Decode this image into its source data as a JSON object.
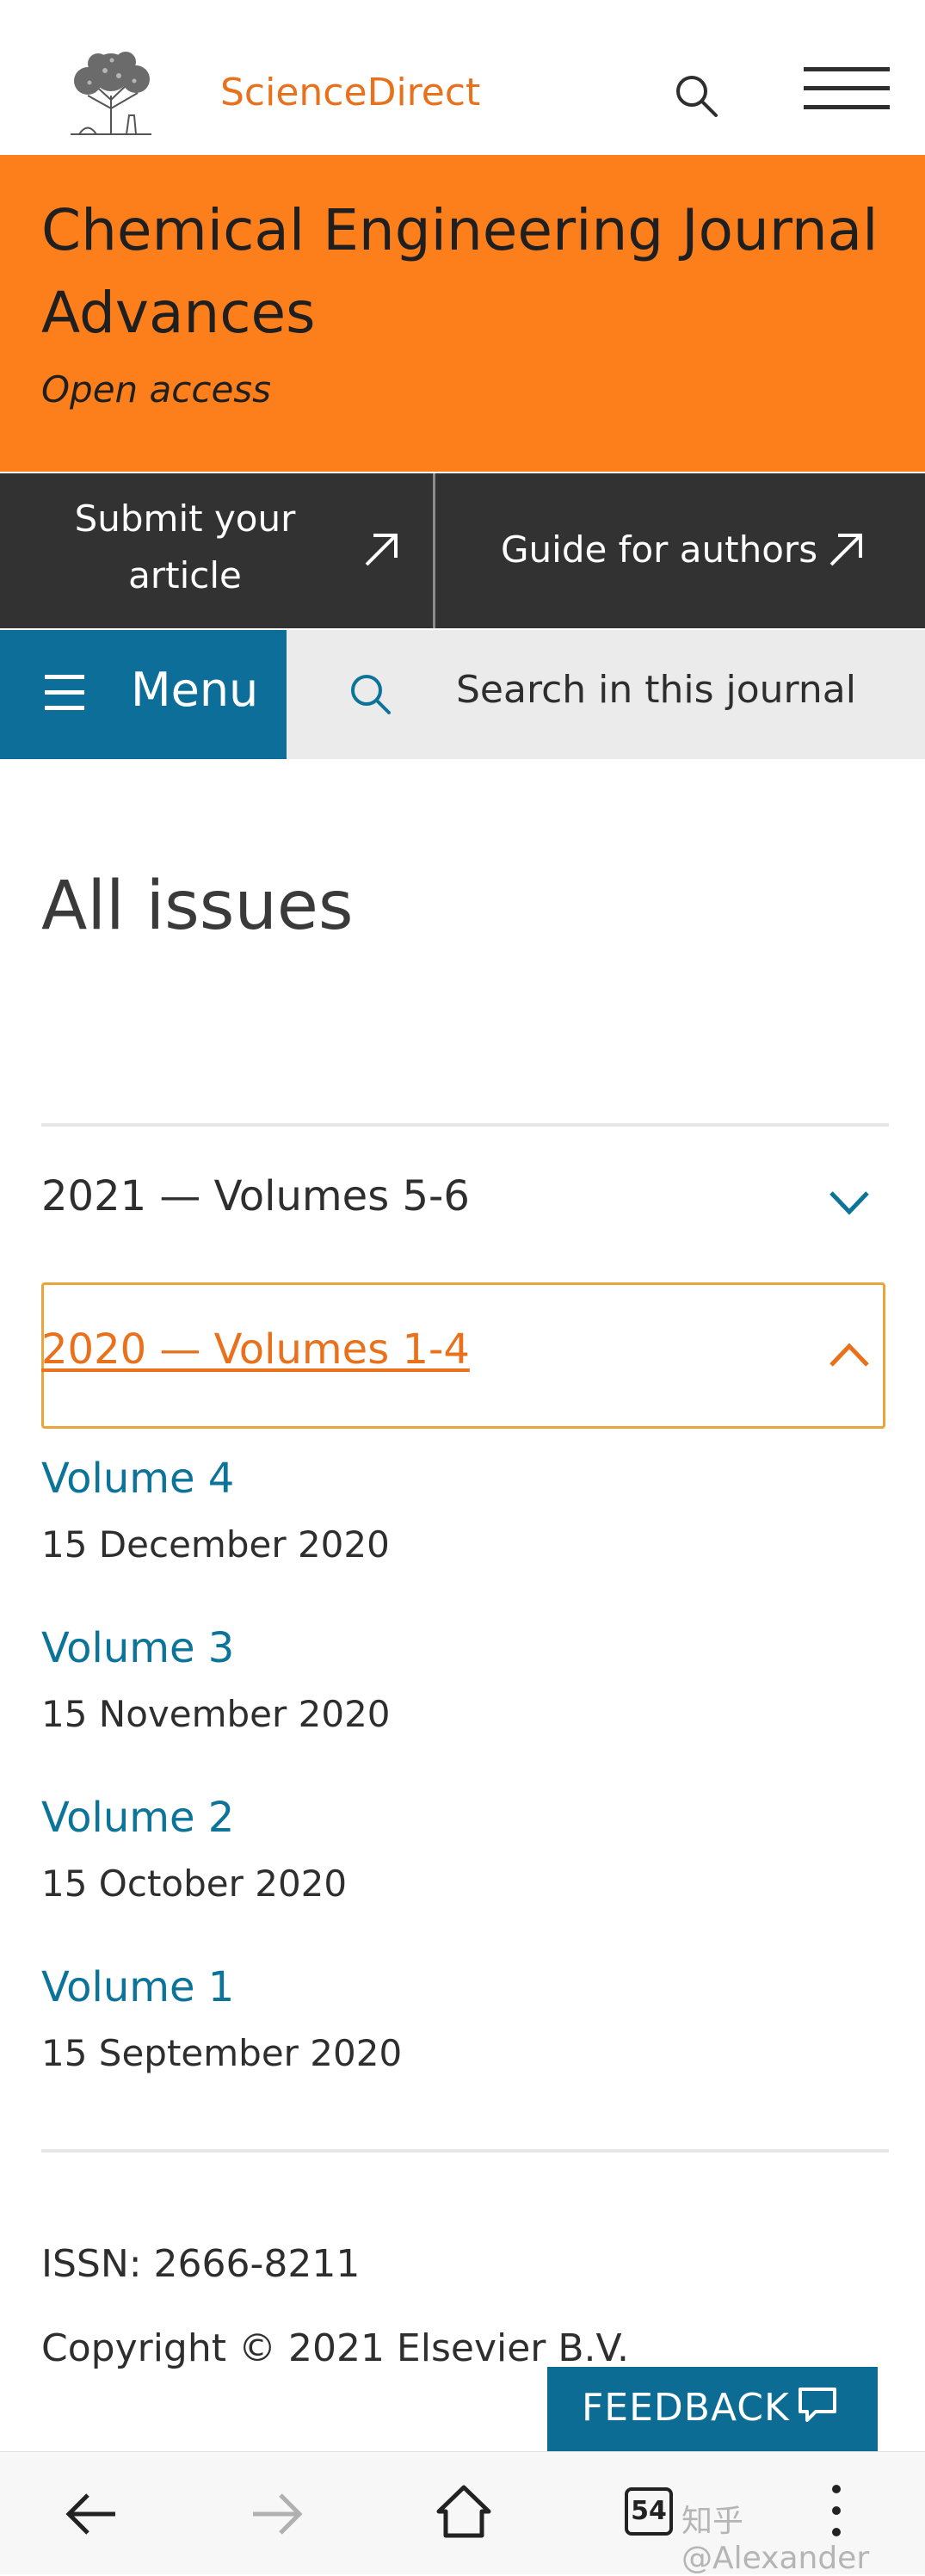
{
  "header": {
    "brand": "ScienceDirect",
    "logo_icon": "elsevier-tree-logo",
    "search_icon": "search-icon",
    "menu_icon": "hamburger-icon"
  },
  "journal": {
    "title": "Chemical Engineering Journal Advances",
    "access": "Open access",
    "banner_color": "#fd7f1c"
  },
  "actions": {
    "submit_line1": "Submit your",
    "submit_line2": "article",
    "guide": "Guide for authors"
  },
  "nav": {
    "menu_label": "Menu",
    "search_placeholder": "Search in this journal",
    "accent": "#0d6e99"
  },
  "main": {
    "page_title": "All issues",
    "accordions": [
      {
        "label": "2021 — Volumes 5-6",
        "expanded": false
      },
      {
        "label": "2020 — Volumes 1-4",
        "expanded": true
      }
    ],
    "volumes": [
      {
        "name": "Volume 4",
        "date": "15 December 2020"
      },
      {
        "name": "Volume 3",
        "date": "15 November 2020"
      },
      {
        "name": "Volume 2",
        "date": "15 October 2020"
      },
      {
        "name": "Volume 1",
        "date": "15 September 2020"
      }
    ],
    "issn": "ISSN: 2666-8211",
    "copyright": "Copyright © 2021 Elsevier B.V."
  },
  "feedback": {
    "label": "FEEDBACK"
  },
  "browser": {
    "tabs_count": "54",
    "watermark": "知乎 @Alexander"
  }
}
